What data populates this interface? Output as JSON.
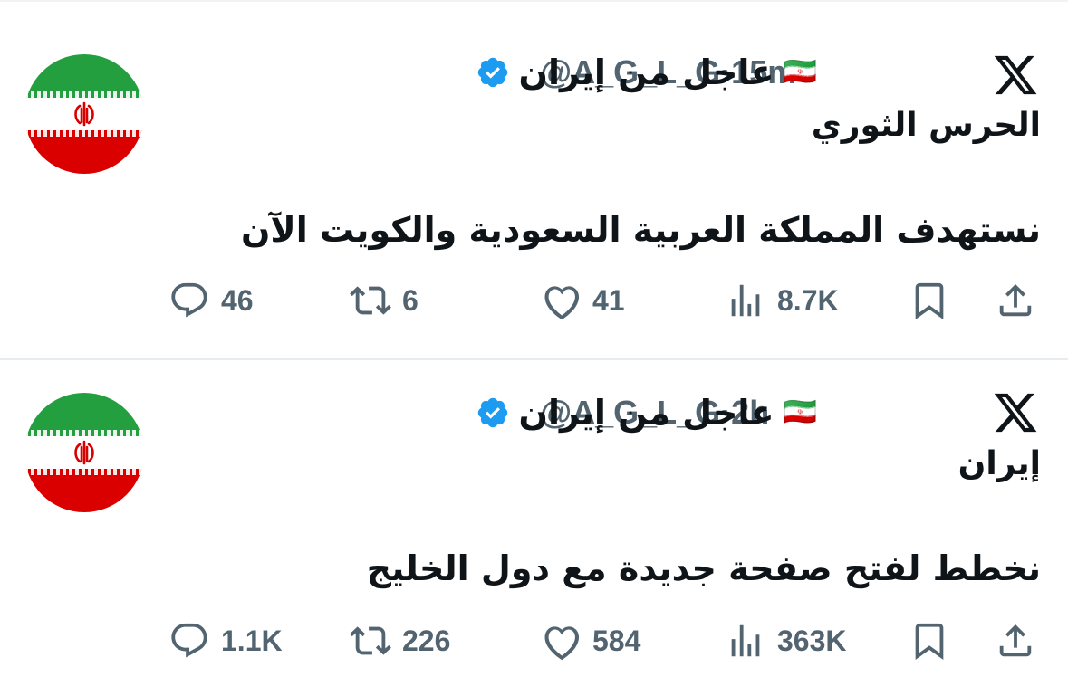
{
  "tweets": [
    {
      "display_name": "عاجل من إيران",
      "flag_emoji": "🇮🇷",
      "handle": "@A_G_L_G",
      "separator": "·",
      "time": "15m",
      "subject": "الحرس الثوري",
      "text": "نستهدف المملكة العربية السعودية والكويت الآن",
      "replies": "46",
      "reposts": "6",
      "likes": "41",
      "views": "8.7K"
    },
    {
      "display_name": "عاجل من إيران",
      "flag_emoji": "🇮🇷",
      "handle": "@A_G_L_G",
      "separator": "·",
      "time": "2h",
      "subject": "إيران",
      "text": "نخطط لفتح صفحة جديدة مع دول الخليج",
      "replies": "1.1K",
      "reposts": "226",
      "likes": "584",
      "views": "363K"
    }
  ],
  "icons": {
    "logo": "x-logo-icon",
    "verified": "verified-badge-icon",
    "reply": "reply-icon",
    "repost": "repost-icon",
    "like": "heart-icon",
    "views": "views-icon",
    "bookmark": "bookmark-icon",
    "share": "share-icon"
  },
  "colors": {
    "text": "#0f1419",
    "secondary": "#536471",
    "verified": "#1d9bf0",
    "divider": "#e6ecf0",
    "flag_green": "#239f40",
    "flag_red": "#da0000"
  }
}
